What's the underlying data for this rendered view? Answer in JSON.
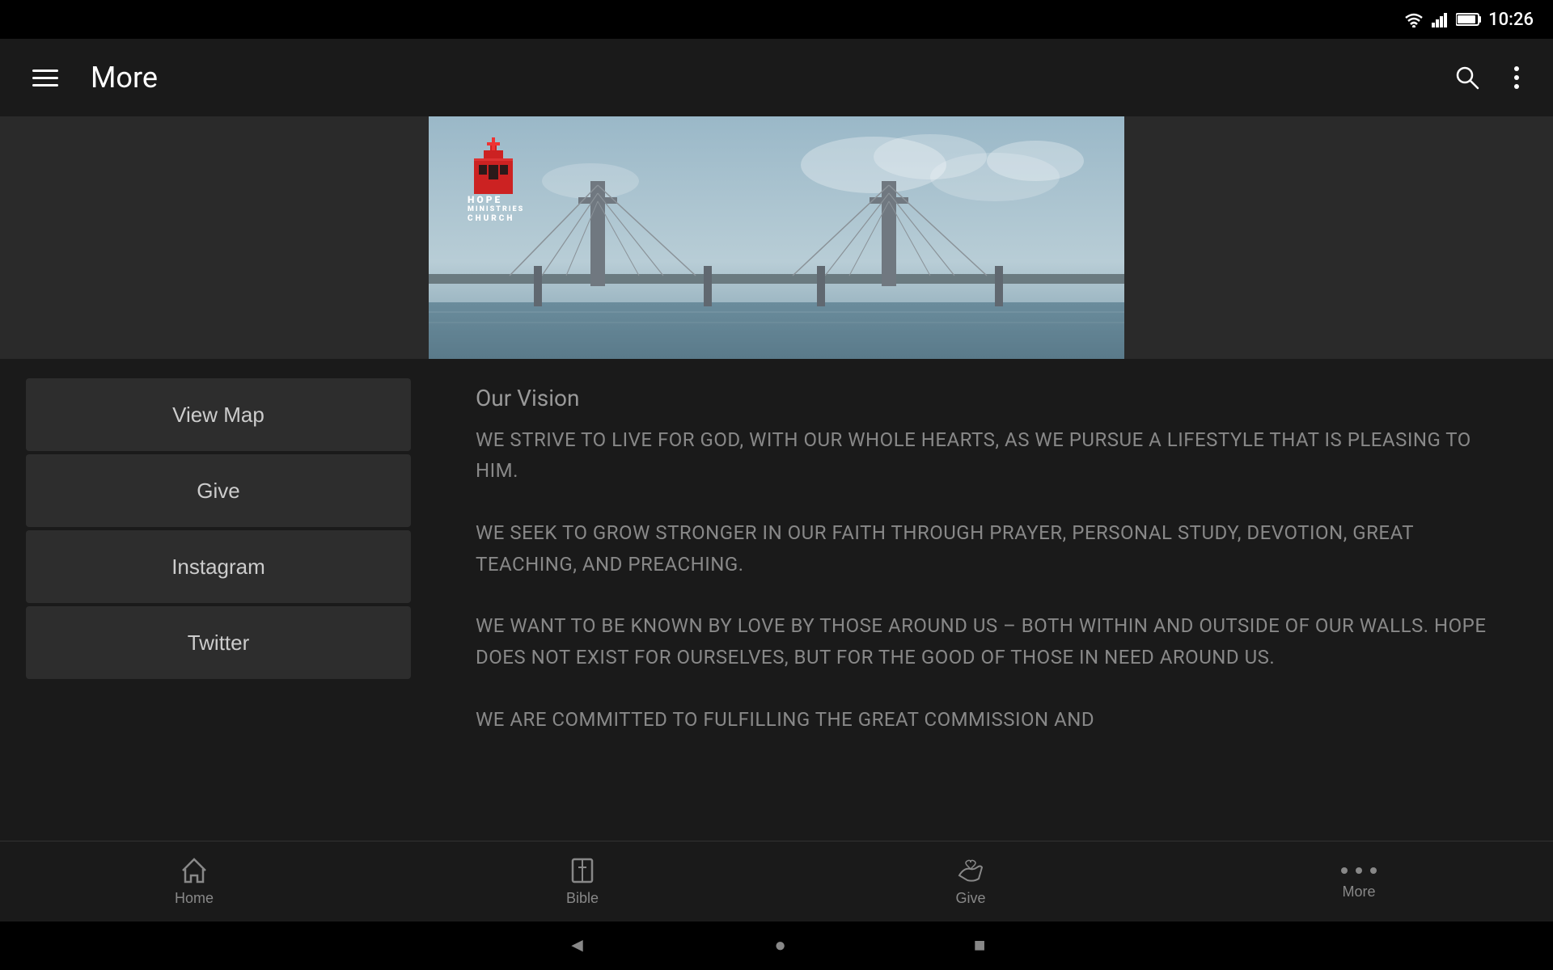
{
  "statusBar": {
    "time": "10:26",
    "wifiIcon": "▼",
    "signalIcon": "▲",
    "batteryIcon": "▓"
  },
  "appBar": {
    "menuIcon": "≡",
    "title": "More",
    "searchIcon": "🔍",
    "moreIcon": "⋮"
  },
  "hero": {
    "logoLines": [
      "HOPE",
      "MINISTRIES",
      "CHURCH"
    ]
  },
  "leftPanel": {
    "buttons": [
      {
        "label": "View Map"
      },
      {
        "label": "Give"
      },
      {
        "label": "Instagram"
      },
      {
        "label": "Twitter"
      }
    ]
  },
  "rightPanel": {
    "visionTitle": "Our Vision",
    "visionText": "WE STRIVE TO LIVE FOR GOD, WITH OUR WHOLE HEARTS, AS WE PURSUE A LIFESTYLE THAT IS PLEASING TO HIM.\nWE SEEK TO GROW STRONGER IN OUR FAITH THROUGH PRAYER, PERSONAL STUDY, DEVOTION, GREAT TEACHING, AND PREACHING.\nWE WANT TO BE KNOWN BY LOVE BY THOSE AROUND US – BOTH WITHIN AND OUTSIDE OF OUR WALLS. HOPE DOES NOT EXIST FOR OURSELVES, BUT FOR THE GOOD OF THOSE IN NEED AROUND US.\nWE ARE COMMITTED TO FULFILLING THE GREAT COMMISSION AND"
  },
  "bottomNav": {
    "items": [
      {
        "id": "home",
        "icon": "🏠",
        "label": "Home"
      },
      {
        "id": "bible",
        "icon": "✛",
        "label": "Bible"
      },
      {
        "id": "give",
        "icon": "🤲",
        "label": "Give"
      },
      {
        "id": "more",
        "icon": "•••",
        "label": "More"
      }
    ]
  },
  "androidNav": {
    "backIcon": "◄",
    "homeIcon": "●",
    "recentIcon": "■"
  }
}
